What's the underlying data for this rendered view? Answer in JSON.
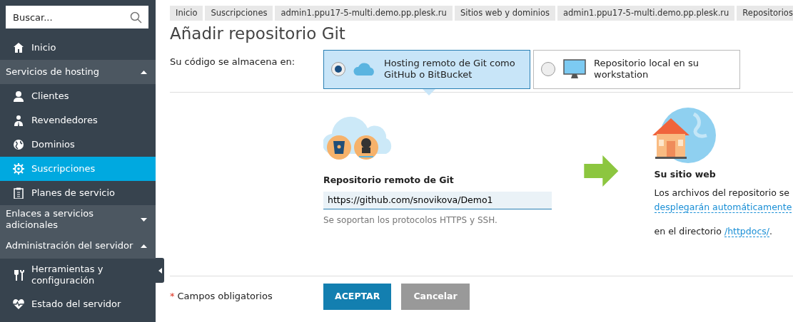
{
  "sidebar": {
    "search": {
      "placeholder": "Buscar..."
    },
    "items": [
      {
        "kind": "link",
        "label": "Inicio",
        "selected": false
      },
      {
        "kind": "section",
        "label": "Servicios de hosting",
        "expanded": true,
        "children": [
          {
            "label": "Clientes",
            "selected": false
          },
          {
            "label": "Revendedores",
            "selected": false
          },
          {
            "label": "Dominios",
            "selected": false
          },
          {
            "label": "Suscripciones",
            "selected": true
          },
          {
            "label": "Planes de servicio",
            "selected": false
          }
        ]
      },
      {
        "kind": "section",
        "label": "Enlaces a servicios adicionales",
        "expanded": false
      },
      {
        "kind": "section",
        "label": "Administración del servidor",
        "expanded": true,
        "children": [
          {
            "label": "Herramientas y configuración",
            "selected": false
          },
          {
            "label": "Estado del servidor",
            "selected": false
          }
        ]
      }
    ]
  },
  "breadcrumbs": [
    "Inicio",
    "Suscripciones",
    "admin1.ppu17-5-multi.demo.pp.plesk.ru",
    "Sitios web y dominios",
    "admin1.ppu17-5-multi.demo.pp.plesk.ru",
    "Repositorios"
  ],
  "title": "Añadir repositorio Git",
  "storage": {
    "label": "Su código se almacena en:",
    "options": [
      {
        "label": "Hosting remoto de Git como GitHub o BitBucket",
        "selected": true
      },
      {
        "label": "Repositorio local en su workstation",
        "selected": false
      }
    ]
  },
  "remote": {
    "heading": "Repositorio remoto de Git",
    "value": "https://github.com/snovikova/Demo1",
    "hint": "Se soportan los protocolos HTTPS y SSH."
  },
  "target": {
    "heading": "Su sitio web",
    "paragraphs": [
      {
        "text": "Los archivos del repositorio se ",
        "link": "desplegarán automáticamente"
      },
      {
        "text": "en el directorio ",
        "link": "/httpdocs/",
        "suffix": "."
      }
    ]
  },
  "required": {
    "mark": "*",
    "label": "Campos obligatorios"
  },
  "buttons": [
    {
      "label": "ACEPTAR",
      "kind": "primary"
    },
    {
      "label": "Cancelar",
      "kind": "secondary"
    }
  ]
}
